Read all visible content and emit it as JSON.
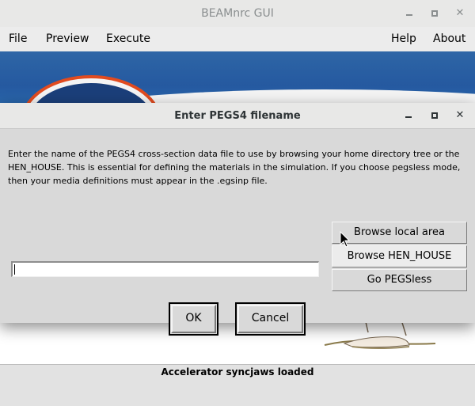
{
  "window": {
    "title": "BEAMnrc GUI",
    "controls": {
      "minimize": "",
      "maximize": "",
      "close": "✕"
    }
  },
  "menubar": {
    "file": "File",
    "preview": "Preview",
    "execute": "Execute",
    "help": "Help",
    "about": "About"
  },
  "status": {
    "text": "Accelerator syncjaws loaded"
  },
  "dialog": {
    "title": "Enter PEGS4 filename",
    "controls": {
      "minimize": "",
      "maximize": "",
      "close": "✕"
    },
    "message": "Enter the name of the PEGS4 cross-section data file to use by browsing your home directory tree or the HEN_HOUSE. This is essential for defining the materials in the simulation. If you choose pegsless mode, then your media definitions must appear in the .egsinp file.",
    "filename_value": "",
    "buttons": {
      "browse_local": "Browse local area",
      "browse_henhouse": "Browse HEN_HOUSE",
      "go_pegsless": "Go PEGSless",
      "ok": "OK",
      "cancel": "Cancel"
    }
  },
  "colors": {
    "banner_blue": "#2559a0",
    "banner_orange": "#e14b1f",
    "dialog_bg": "#d9d9d9"
  }
}
